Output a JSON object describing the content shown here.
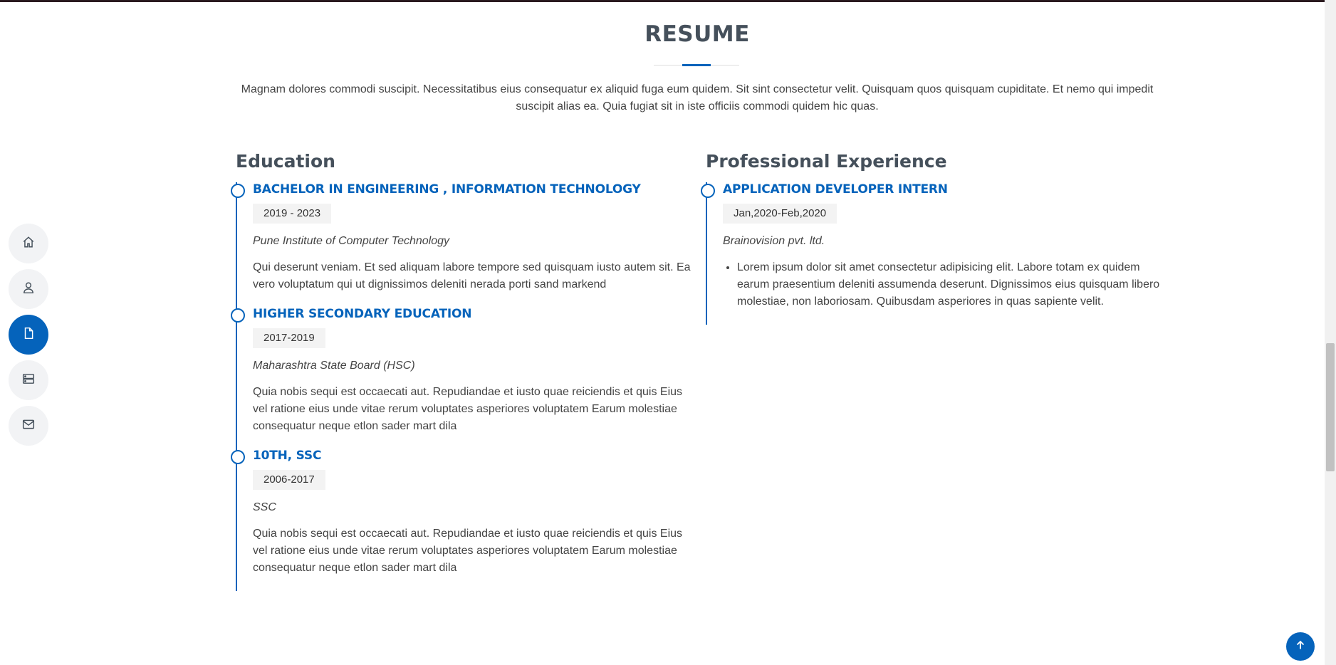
{
  "header": {
    "title": "RESUME",
    "description": "Magnam dolores commodi suscipit. Necessitatibus eius consequatur ex aliquid fuga eum quidem. Sit sint consectetur velit. Quisquam quos quisquam cupiditate. Et nemo qui impedit suscipit alias ea. Quia fugiat sit in iste officiis commodi quidem hic quas."
  },
  "nav": {
    "items": [
      {
        "icon": "home-icon",
        "active": false
      },
      {
        "icon": "person-icon",
        "active": false
      },
      {
        "icon": "file-icon",
        "active": true
      },
      {
        "icon": "server-icon",
        "active": false
      },
      {
        "icon": "envelope-icon",
        "active": false
      }
    ]
  },
  "education": {
    "title": "Education",
    "items": [
      {
        "title": "BACHELOR IN ENGINEERING , INFORMATION TECHNOLOGY",
        "date": "2019 - 2023",
        "org": "Pune Institute of Computer Technology",
        "text": "Qui deserunt veniam. Et sed aliquam labore tempore sed quisquam iusto autem sit. Ea vero voluptatum qui ut dignissimos deleniti nerada porti sand markend"
      },
      {
        "title": "HIGHER SECONDARY EDUCATION",
        "date": "2017-2019",
        "org": "Maharashtra State Board (HSC)",
        "text": "Quia nobis sequi est occaecati aut. Repudiandae et iusto quae reiciendis et quis Eius vel ratione eius unde vitae rerum voluptates asperiores voluptatem Earum molestiae consequatur neque etlon sader mart dila"
      },
      {
        "title": "10TH, SSC",
        "date": "2006-2017",
        "org": "SSC",
        "text": "Quia nobis sequi est occaecati aut. Repudiandae et iusto quae reiciendis et quis Eius vel ratione eius unde vitae rerum voluptates asperiores voluptatem Earum molestiae consequatur neque etlon sader mart dila"
      }
    ]
  },
  "experience": {
    "title": "Professional Experience",
    "items": [
      {
        "title": "APPLICATION DEVELOPER INTERN",
        "date": "Jan,2020-Feb,2020",
        "org": "Brainovision pvt. ltd.",
        "bullets": [
          "Lorem ipsum dolor sit amet consectetur adipisicing elit. Labore totam ex quidem earum praesentium deleniti assumenda deserunt. Dignissimos eius quisquam libero molestiae, non laboriosam. Quibusdam asperiores in quas sapiente velit."
        ]
      }
    ]
  },
  "colors": {
    "accent": "#0563bb",
    "heading": "#45505b",
    "text": "#444444"
  }
}
